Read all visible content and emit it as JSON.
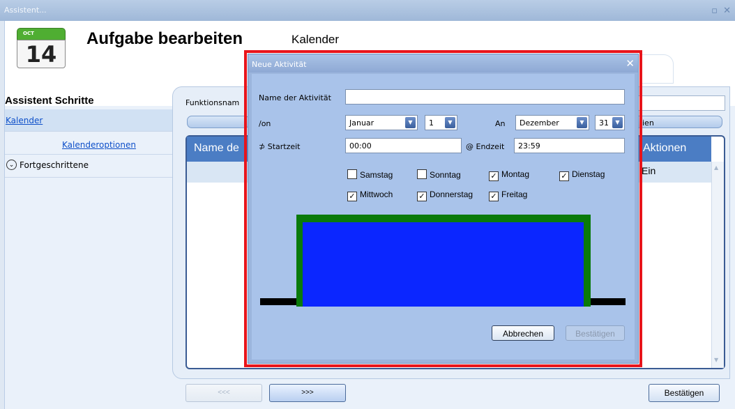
{
  "window": {
    "title": "Assistent...",
    "controls": "▫ ✕"
  },
  "header": {
    "calendar_month": "OCT",
    "calendar_day": "14",
    "title": "Aufgabe bearbeiten",
    "subtitle": "Kalender"
  },
  "sidebar": {
    "title": "Assistent Schritte",
    "items": [
      {
        "label": "Kalender",
        "active": true
      },
      {
        "label": "Kalenderoptionen"
      },
      {
        "label": "Fortgeschrittene"
      }
    ]
  },
  "main": {
    "function_name_label": "Funktionsnam",
    "right_bar_label": "ien",
    "table": {
      "columns": [
        "Name de",
        "Aktionen"
      ],
      "rows": [
        {
          "action": "Ein"
        }
      ]
    }
  },
  "nav": {
    "prev_label": "<<<",
    "next_label": ">>>",
    "confirm_label": "Bestätigen"
  },
  "dialog": {
    "title": "Neue Aktivität",
    "name_label": "Name der Aktivität",
    "name_value": "",
    "from_label": "/on",
    "from_month": "Januar",
    "from_day": "1",
    "to_label": "An",
    "to_month": "Dezember",
    "to_day": "31",
    "start_label": "⊅ Startzeit",
    "start_value": "00:00",
    "end_label": "@ Endzeit",
    "end_value": "23:59",
    "days": [
      {
        "label": "Samstag",
        "checked": false
      },
      {
        "label": "Sonntag",
        "checked": false
      },
      {
        "label": "Montag",
        "checked": true
      },
      {
        "label": "Dienstag",
        "checked": true
      },
      {
        "label": "Mittwoch",
        "checked": true
      },
      {
        "label": "Donnerstag",
        "checked": true
      },
      {
        "label": "Freitag",
        "checked": true
      }
    ],
    "cancel_label": "Abbrechen",
    "confirm_label": "Bestätigen"
  },
  "colors": {
    "highlight": "#e8141b",
    "graph_fill": "#0b26ff",
    "graph_border": "#0a7a0a",
    "graph_baseline": "#000000"
  }
}
